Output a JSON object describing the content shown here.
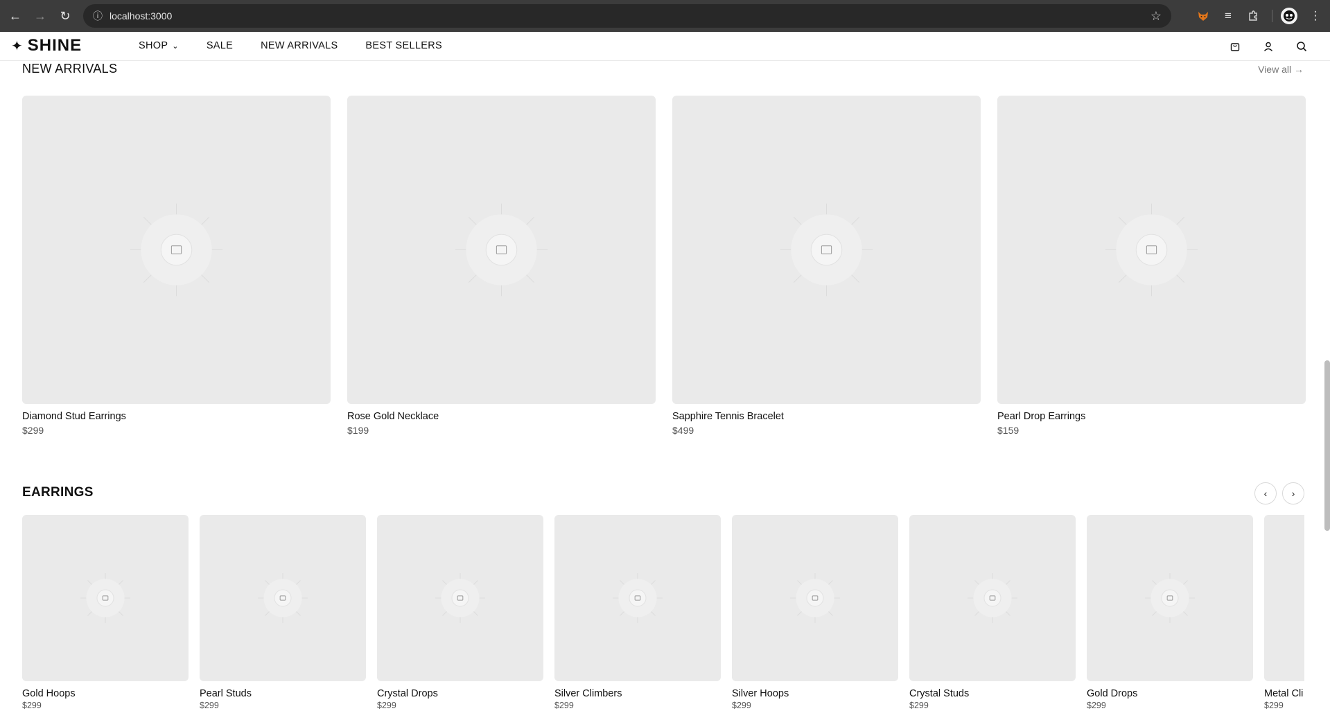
{
  "browser": {
    "url": "localhost:3000",
    "back_icon": "arrow-left-icon",
    "forward_icon": "arrow-right-icon",
    "reload_icon": "reload-icon"
  },
  "site": {
    "logo_mark": "✦",
    "logo_text": "SHINE",
    "nav": [
      {
        "label": "SHOP",
        "has_dropdown": true
      },
      {
        "label": "SALE"
      },
      {
        "label": "NEW ARRIVALS"
      },
      {
        "label": "BEST SELLERS"
      }
    ]
  },
  "new_arrivals": {
    "title": "NEW ARRIVALS",
    "view_all": "View all →",
    "products": [
      {
        "name": "Diamond Stud Earrings",
        "price": "$299"
      },
      {
        "name": "Rose Gold Necklace",
        "price": "$199"
      },
      {
        "name": "Sapphire Tennis Bracelet",
        "price": "$499"
      },
      {
        "name": "Pearl Drop Earrings",
        "price": "$159"
      }
    ]
  },
  "earrings": {
    "title": "EARRINGS",
    "prev_label": "‹",
    "next_label": "›",
    "products": [
      {
        "name": "Gold Hoops",
        "price": "$299"
      },
      {
        "name": "Pearl Studs",
        "price": "$299"
      },
      {
        "name": "Crystal Drops",
        "price": "$299"
      },
      {
        "name": "Silver Climbers",
        "price": "$299"
      },
      {
        "name": "Silver Hoops",
        "price": "$299"
      },
      {
        "name": "Crystal Studs",
        "price": "$299"
      },
      {
        "name": "Gold Drops",
        "price": "$299"
      },
      {
        "name": "Metal Cli",
        "price": "$299"
      }
    ]
  }
}
